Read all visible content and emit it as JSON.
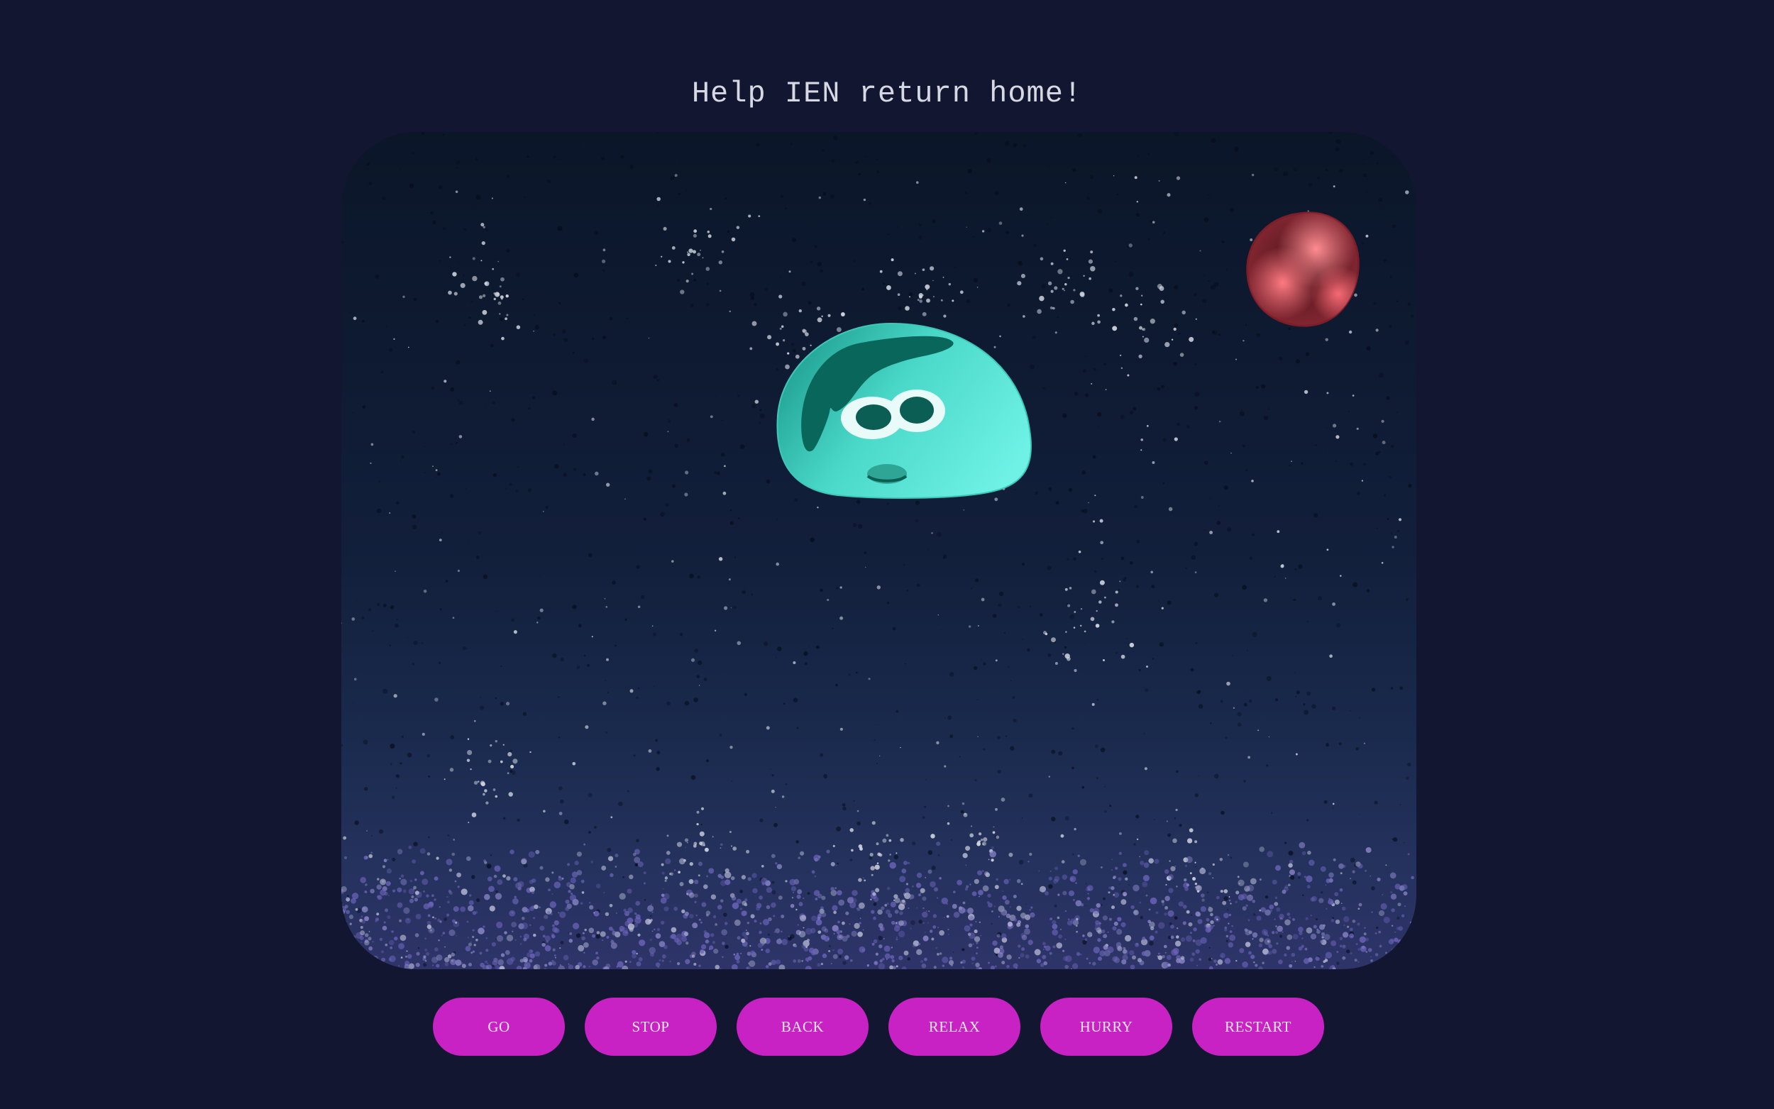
{
  "header": {
    "title": "Help IEN return home!"
  },
  "scene": {
    "character": "IEN",
    "character_color": "#5fe3d6",
    "planet_color": "#a0323e",
    "background_top": "#0b1629",
    "background_bottom": "#2e3469"
  },
  "controls": {
    "go_label": "GO",
    "stop_label": "STOP",
    "back_label": "BACK",
    "relax_label": "RELAX",
    "hurry_label": "HURRY",
    "restart_label": "RESTART",
    "button_color": "#c821c4"
  }
}
